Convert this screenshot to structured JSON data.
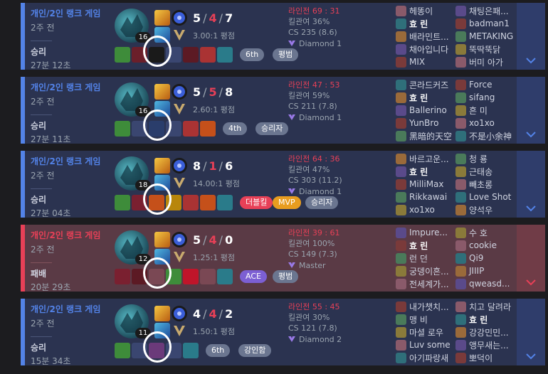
{
  "colors": {
    "win": "#5383e8",
    "loss": "#e84057",
    "win_bg": "#2b3350",
    "loss_bg": "#5a3a45"
  },
  "matches": [
    {
      "type": "개인/2인 랭크 게임",
      "ago": "2주 전",
      "result": "승리",
      "duration": "27분 12초",
      "win": true,
      "level": "16",
      "kills": "5",
      "deaths": "4",
      "assists": "7",
      "ratio": "3.00:1 평점",
      "kp": "킬관여 36%",
      "cs": "CS 235 (8.6)",
      "laning": "라인전 69 : 31",
      "tier": "Diamond 1",
      "badges": [
        {
          "label": "6th",
          "style": "plain"
        },
        {
          "label": "평범",
          "style": "plain"
        }
      ],
      "team1": [
        "헤똥이",
        "효 린",
        "배라민트...",
        "채아입니다",
        "MIX"
      ],
      "team2": [
        "채팅은패...",
        "badman1",
        "METAKING",
        "뚝딱뚝닭",
        "버미 아가"
      ]
    },
    {
      "type": "개인/2인 랭크 게임",
      "ago": "2주 전",
      "result": "승리",
      "duration": "27분 11초",
      "win": true,
      "level": "16",
      "kills": "5",
      "deaths": "5",
      "assists": "8",
      "ratio": "2.60:1 평점",
      "kp": "킬관여 59%",
      "cs": "CS 211 (7.8)",
      "laning": "라인전 47 : 53",
      "tier": "Diamond 1",
      "badges": [
        {
          "label": "4th",
          "style": "plain"
        },
        {
          "label": "승리자",
          "style": "plain"
        }
      ],
      "team1": [
        "콘라드커즈",
        "효 린",
        "Ballerino",
        "YunBro",
        "黑暗的天空"
      ],
      "team2": [
        "Force",
        "sifang",
        "흔 미",
        "xo1xo",
        "不是小余神"
      ]
    },
    {
      "type": "개인/2인 랭크 게임",
      "ago": "2주 전",
      "result": "승리",
      "duration": "27분 04초",
      "win": true,
      "level": "18",
      "kills": "8",
      "deaths": "1",
      "assists": "6",
      "ratio": "14.00:1 평점",
      "kp": "킬관여 47%",
      "cs": "CS 303 (11.2)",
      "laning": "라인전 64 : 36",
      "tier": "Diamond 1",
      "badges": [
        {
          "label": "더블킬",
          "style": "red"
        },
        {
          "label": "MVP",
          "style": "gold"
        },
        {
          "label": "승리자",
          "style": "plain"
        }
      ],
      "team1": [
        "바르고운...",
        "효 린",
        "MilliMax",
        "Rikkawai",
        "xo1xo"
      ],
      "team2": [
        "청 룡",
        "근태송",
        "빼초롱",
        "Love Shot",
        "양석우"
      ]
    },
    {
      "type": "개인/2인 랭크 게임",
      "ago": "2주 전",
      "result": "패배",
      "duration": "20분 29초",
      "win": false,
      "level": "12",
      "kills": "5",
      "deaths": "4",
      "assists": "0",
      "ratio": "1.25:1 평점",
      "kp": "킬관여 100%",
      "cs": "CS 149 (7.3)",
      "laning": "라인전 39 : 61",
      "tier": "Master",
      "badges": [
        {
          "label": "ACE",
          "style": "purple"
        },
        {
          "label": "평범",
          "style": "plain"
        }
      ],
      "team1": [
        "Impure...",
        "효 린",
        "런 던",
        "궁뎅이흔...",
        "전세계가..."
      ],
      "team2": [
        "수 호",
        "cookie",
        "Qi9",
        "JIIIP",
        "qweasd..."
      ]
    },
    {
      "type": "개인/2인 랭크 게임",
      "ago": "2주 전",
      "result": "승리",
      "duration": "15분 34초",
      "win": true,
      "level": "11",
      "kills": "4",
      "deaths": "4",
      "assists": "2",
      "ratio": "1.50:1 평점",
      "kp": "킬관여 30%",
      "cs": "CS 121 (7.8)",
      "laning": "라인전 55 : 45",
      "tier": "Diamond 2",
      "badges": [
        {
          "label": "6th",
          "style": "plain"
        },
        {
          "label": "강인함",
          "style": "plain"
        }
      ],
      "team1": [
        "내가챗치...",
        "맹 비",
        "마셜 로우",
        "Luv some",
        "아기파랑새"
      ],
      "team2": [
        "치고 달려라",
        "효 린",
        "강강민민...",
        "앵무새는...",
        "뽀덕이"
      ]
    }
  ]
}
